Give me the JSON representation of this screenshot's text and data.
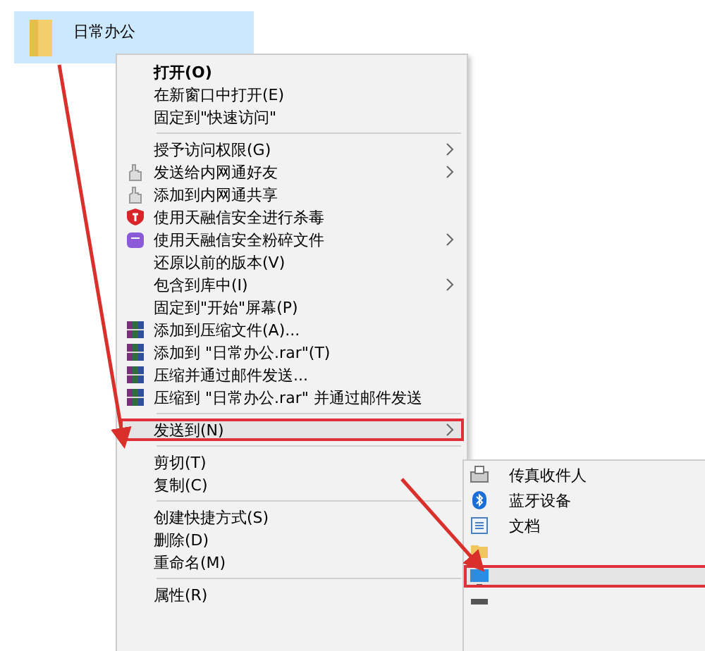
{
  "folder": {
    "label": "日常办公",
    "selected": true
  },
  "context_menu": {
    "items": [
      {
        "kind": "plain",
        "label": "打开(O)",
        "bold": true,
        "submenu": false,
        "selected": false
      },
      {
        "kind": "plain",
        "label": "在新窗口中打开(E)",
        "bold": false,
        "submenu": false,
        "selected": false
      },
      {
        "kind": "plain",
        "label": "固定到\"快速访问\"",
        "bold": false,
        "submenu": false,
        "selected": false
      },
      {
        "kind": "separator"
      },
      {
        "kind": "plain",
        "label": "授予访问权限(G)",
        "bold": false,
        "submenu": true,
        "selected": false
      },
      {
        "kind": "hand",
        "label": "发送给内网通好友",
        "bold": false,
        "submenu": true,
        "selected": false
      },
      {
        "kind": "hand",
        "label": "添加到内网通共享",
        "bold": false,
        "submenu": false,
        "selected": false
      },
      {
        "kind": "shield",
        "label": "使用天融信安全进行杀毒",
        "bold": false,
        "submenu": false,
        "selected": false
      },
      {
        "kind": "shredder",
        "label": "使用天融信安全粉碎文件",
        "bold": false,
        "submenu": true,
        "selected": false
      },
      {
        "kind": "plain",
        "label": "还原以前的版本(V)",
        "bold": false,
        "submenu": false,
        "selected": false
      },
      {
        "kind": "plain",
        "label": "包含到库中(I)",
        "bold": false,
        "submenu": true,
        "selected": false
      },
      {
        "kind": "plain",
        "label": "固定到\"开始\"屏幕(P)",
        "bold": false,
        "submenu": false,
        "selected": false
      },
      {
        "kind": "archive",
        "label": "添加到压缩文件(A)...",
        "bold": false,
        "submenu": false,
        "selected": false
      },
      {
        "kind": "archive",
        "label": "添加到 \"日常办公.rar\"(T)",
        "bold": false,
        "submenu": false,
        "selected": false
      },
      {
        "kind": "archive",
        "label": "压缩并通过邮件发送...",
        "bold": false,
        "submenu": false,
        "selected": false
      },
      {
        "kind": "archive",
        "label": "压缩到 \"日常办公.rar\" 并通过邮件发送",
        "bold": false,
        "submenu": false,
        "selected": false
      },
      {
        "kind": "separator"
      },
      {
        "kind": "plain",
        "label": "发送到(N)",
        "bold": false,
        "submenu": true,
        "selected": true
      },
      {
        "kind": "separator"
      },
      {
        "kind": "plain",
        "label": "剪切(T)",
        "bold": false,
        "submenu": false,
        "selected": false
      },
      {
        "kind": "plain",
        "label": "复制(C)",
        "bold": false,
        "submenu": false,
        "selected": false
      },
      {
        "kind": "separator"
      },
      {
        "kind": "plain",
        "label": "创建快捷方式(S)",
        "bold": false,
        "submenu": false,
        "selected": false
      },
      {
        "kind": "plain",
        "label": "删除(D)",
        "bold": false,
        "submenu": false,
        "selected": false
      },
      {
        "kind": "plain",
        "label": "重命名(M)",
        "bold": false,
        "submenu": false,
        "selected": false
      },
      {
        "kind": "separator"
      },
      {
        "kind": "plain",
        "label": "属性(R)",
        "bold": false,
        "submenu": false,
        "selected": false
      }
    ]
  },
  "send_to_menu": {
    "items": [
      {
        "kind": "fax",
        "label": "传真收件人",
        "selected": false
      },
      {
        "kind": "bluetooth",
        "label": "蓝牙设备",
        "selected": false
      },
      {
        "kind": "document",
        "label": "文档",
        "selected": false
      },
      {
        "kind": "folder",
        "selected": false
      },
      {
        "kind": "desktop",
        "selected": true
      },
      {
        "kind": "drive",
        "selected": false
      }
    ]
  }
}
